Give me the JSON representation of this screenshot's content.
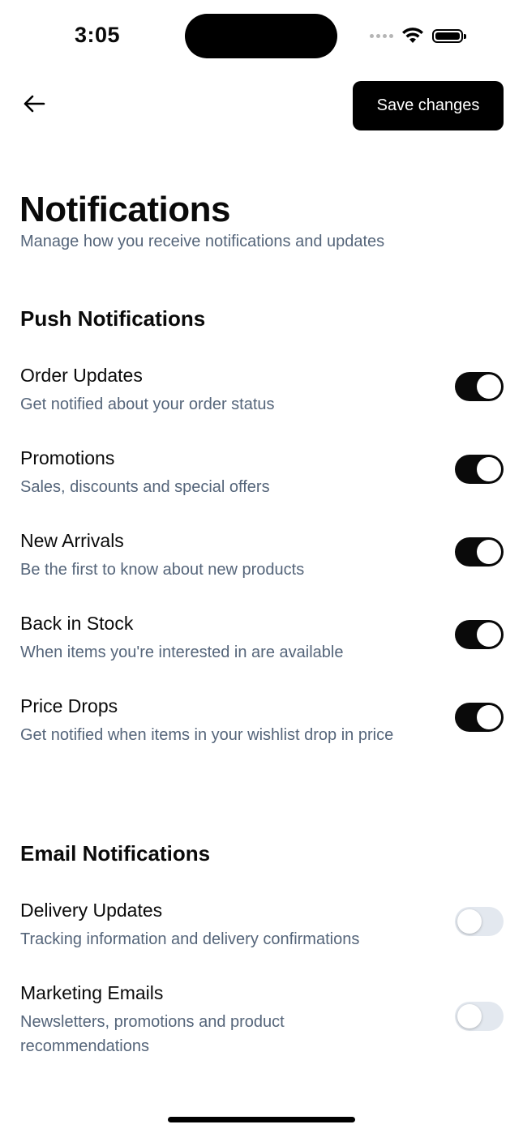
{
  "status_bar": {
    "time": "3:05"
  },
  "header": {
    "save_label": "Save changes"
  },
  "page": {
    "title": "Notifications",
    "subtitle": "Manage how you receive notifications and updates"
  },
  "push": {
    "title": "Push Notifications",
    "items": [
      {
        "title": "Order Updates",
        "desc": "Get notified about your order status",
        "enabled": true
      },
      {
        "title": "Promotions",
        "desc": "Sales, discounts and special offers",
        "enabled": true
      },
      {
        "title": "New Arrivals",
        "desc": "Be the first to know about new products",
        "enabled": true
      },
      {
        "title": "Back in Stock",
        "desc": "When items you're interested in are available",
        "enabled": true
      },
      {
        "title": "Price Drops",
        "desc": "Get notified when items in your wishlist drop in price",
        "enabled": true
      }
    ]
  },
  "email": {
    "title": "Email Notifications",
    "items": [
      {
        "title": "Delivery Updates",
        "desc": "Tracking information and delivery confirmations",
        "enabled": false
      },
      {
        "title": "Marketing Emails",
        "desc": "Newsletters, promotions and product recommendations",
        "enabled": false
      }
    ]
  },
  "icons": {
    "back": "arrow-left-icon",
    "wifi": "wifi-icon",
    "battery": "battery-icon",
    "signal": "signal-icon"
  }
}
